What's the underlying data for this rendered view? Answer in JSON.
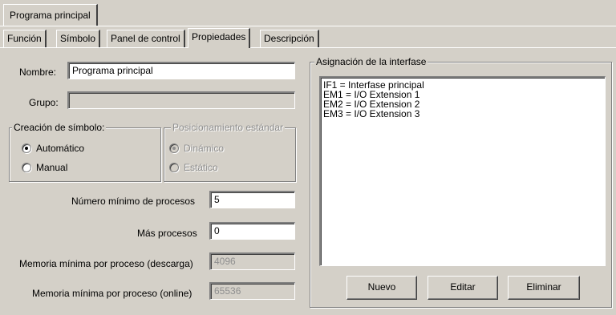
{
  "document_tab": "Programa principal",
  "tabs": [
    {
      "label": "Función"
    },
    {
      "label": "Símbolo"
    },
    {
      "label": "Panel de control"
    },
    {
      "label": "Propiedades"
    },
    {
      "label": "Descripción"
    }
  ],
  "active_tab": "Propiedades",
  "form": {
    "nombre_label": "Nombre:",
    "nombre_value": "Programa principal",
    "grupo_label": "Grupo:",
    "grupo_value": ""
  },
  "creacion_simbolo": {
    "legend": "Creación de símbolo:",
    "options": [
      {
        "label": "Automático",
        "selected": true
      },
      {
        "label": "Manual",
        "selected": false
      }
    ]
  },
  "posicionamiento": {
    "legend": "Posicionamiento estándar",
    "enabled": false,
    "options": [
      {
        "label": "Dinámico",
        "selected": true
      },
      {
        "label": "Estático",
        "selected": false
      }
    ]
  },
  "procesos": {
    "min_label": "Número mínimo de procesos",
    "min_value": "5",
    "mas_label": "Más procesos",
    "mas_value": "0",
    "mem_descarga_label": "Memoria mínima por proceso (descarga)",
    "mem_descarga_value": "4096",
    "mem_online_label": "Memoria mínima por proceso (online)",
    "mem_online_value": "65536"
  },
  "interfase": {
    "legend": "Asignación de la interfase",
    "items": [
      "IF1 = Interfase principal",
      "EM1 = I/O Extension 1",
      "EM2 = I/O Extension 2",
      "EM3 = I/O Extension 3"
    ],
    "buttons": {
      "nuevo": "Nuevo",
      "editar": "Editar",
      "eliminar": "Eliminar"
    }
  }
}
